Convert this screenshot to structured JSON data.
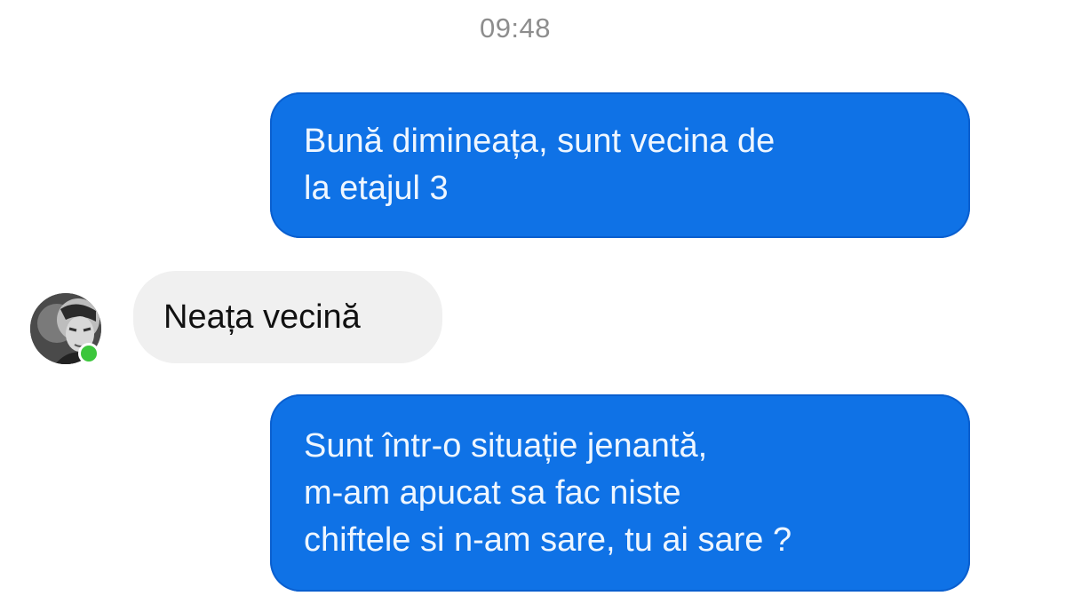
{
  "chat": {
    "timestamp": "09:48",
    "messages": [
      {
        "direction": "outgoing",
        "text": "Bună dimineața, sunt vecina de\nla etajul 3"
      },
      {
        "direction": "incoming",
        "text": "Neața vecină",
        "sender_avatar_icon": "user-avatar",
        "sender_online": true
      },
      {
        "direction": "outgoing",
        "text": "Sunt într-o situație jenantă,\nm-am apucat sa fac niste\nchiftele si n-am sare, tu ai sare ?"
      }
    ]
  },
  "colors": {
    "outgoing_bubble": "#0f72e6",
    "outgoing_text": "#eef6ff",
    "incoming_bubble": "#f0f0f0",
    "incoming_text": "#111111",
    "timestamp_text": "#8d8d8d",
    "online_indicator": "#3cc63c"
  }
}
